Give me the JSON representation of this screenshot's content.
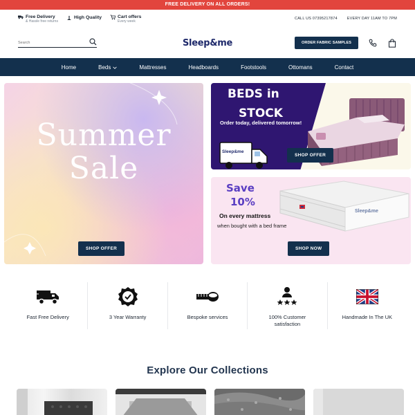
{
  "topbar": {
    "text": "FREE DELIVERY ON ALL ORDERS!"
  },
  "infobar": {
    "items": [
      {
        "title": "Free Delivery",
        "sub": "& Hassle free returns",
        "icon": "truck-icon"
      },
      {
        "title": "High Quality",
        "sub": "",
        "icon": "quality-icon"
      },
      {
        "title": "Cart offers",
        "sub": "Every week",
        "icon": "cart-icon"
      }
    ],
    "phone": "CALL US 07395217874",
    "hours": "EVERY DAY 11AM TO 7PM"
  },
  "header": {
    "search_placeholder": "Search",
    "logo": "Sleep&me",
    "samples_button": "ORDER FABRIC SAMPLES"
  },
  "nav": {
    "items": [
      "Home",
      "Beds",
      "Mattresses",
      "Headboards",
      "Footstools",
      "Ottomans",
      "Contact"
    ]
  },
  "hero": {
    "summer": {
      "line1": "Summer",
      "line2": "Sale",
      "button": "SHOP OFFER"
    },
    "beds": {
      "line1": "BEDS in",
      "line2": "STOCK",
      "sub": "Order today, delivered tomorrow!",
      "van_logo": "Sleep&me",
      "button": "SHOP OFFER"
    },
    "mattress": {
      "line1": "Save",
      "line2": "10%",
      "text1": "On every mattress",
      "text2": "when bought with a bed frame",
      "brand": "Sleep&me",
      "button": "SHOP NOW"
    }
  },
  "features": [
    {
      "label": "Fast Free Delivery",
      "icon": "delivery-truck-icon"
    },
    {
      "label": "3 Year Warranty",
      "icon": "warranty-badge-icon"
    },
    {
      "label": "Bespoke services",
      "icon": "tape-measure-icon"
    },
    {
      "label": "100% Customer satisfaction",
      "icon": "customer-rating-icon"
    },
    {
      "label": "Handmade In The UK",
      "icon": "uk-flag-icon"
    }
  ],
  "collections": {
    "title": "Explore Our Collections"
  },
  "colors": {
    "navy": "#13304d",
    "red_banner": "#e2453d",
    "purple": "#2f1671",
    "pink_bg": "#fae5f1"
  }
}
